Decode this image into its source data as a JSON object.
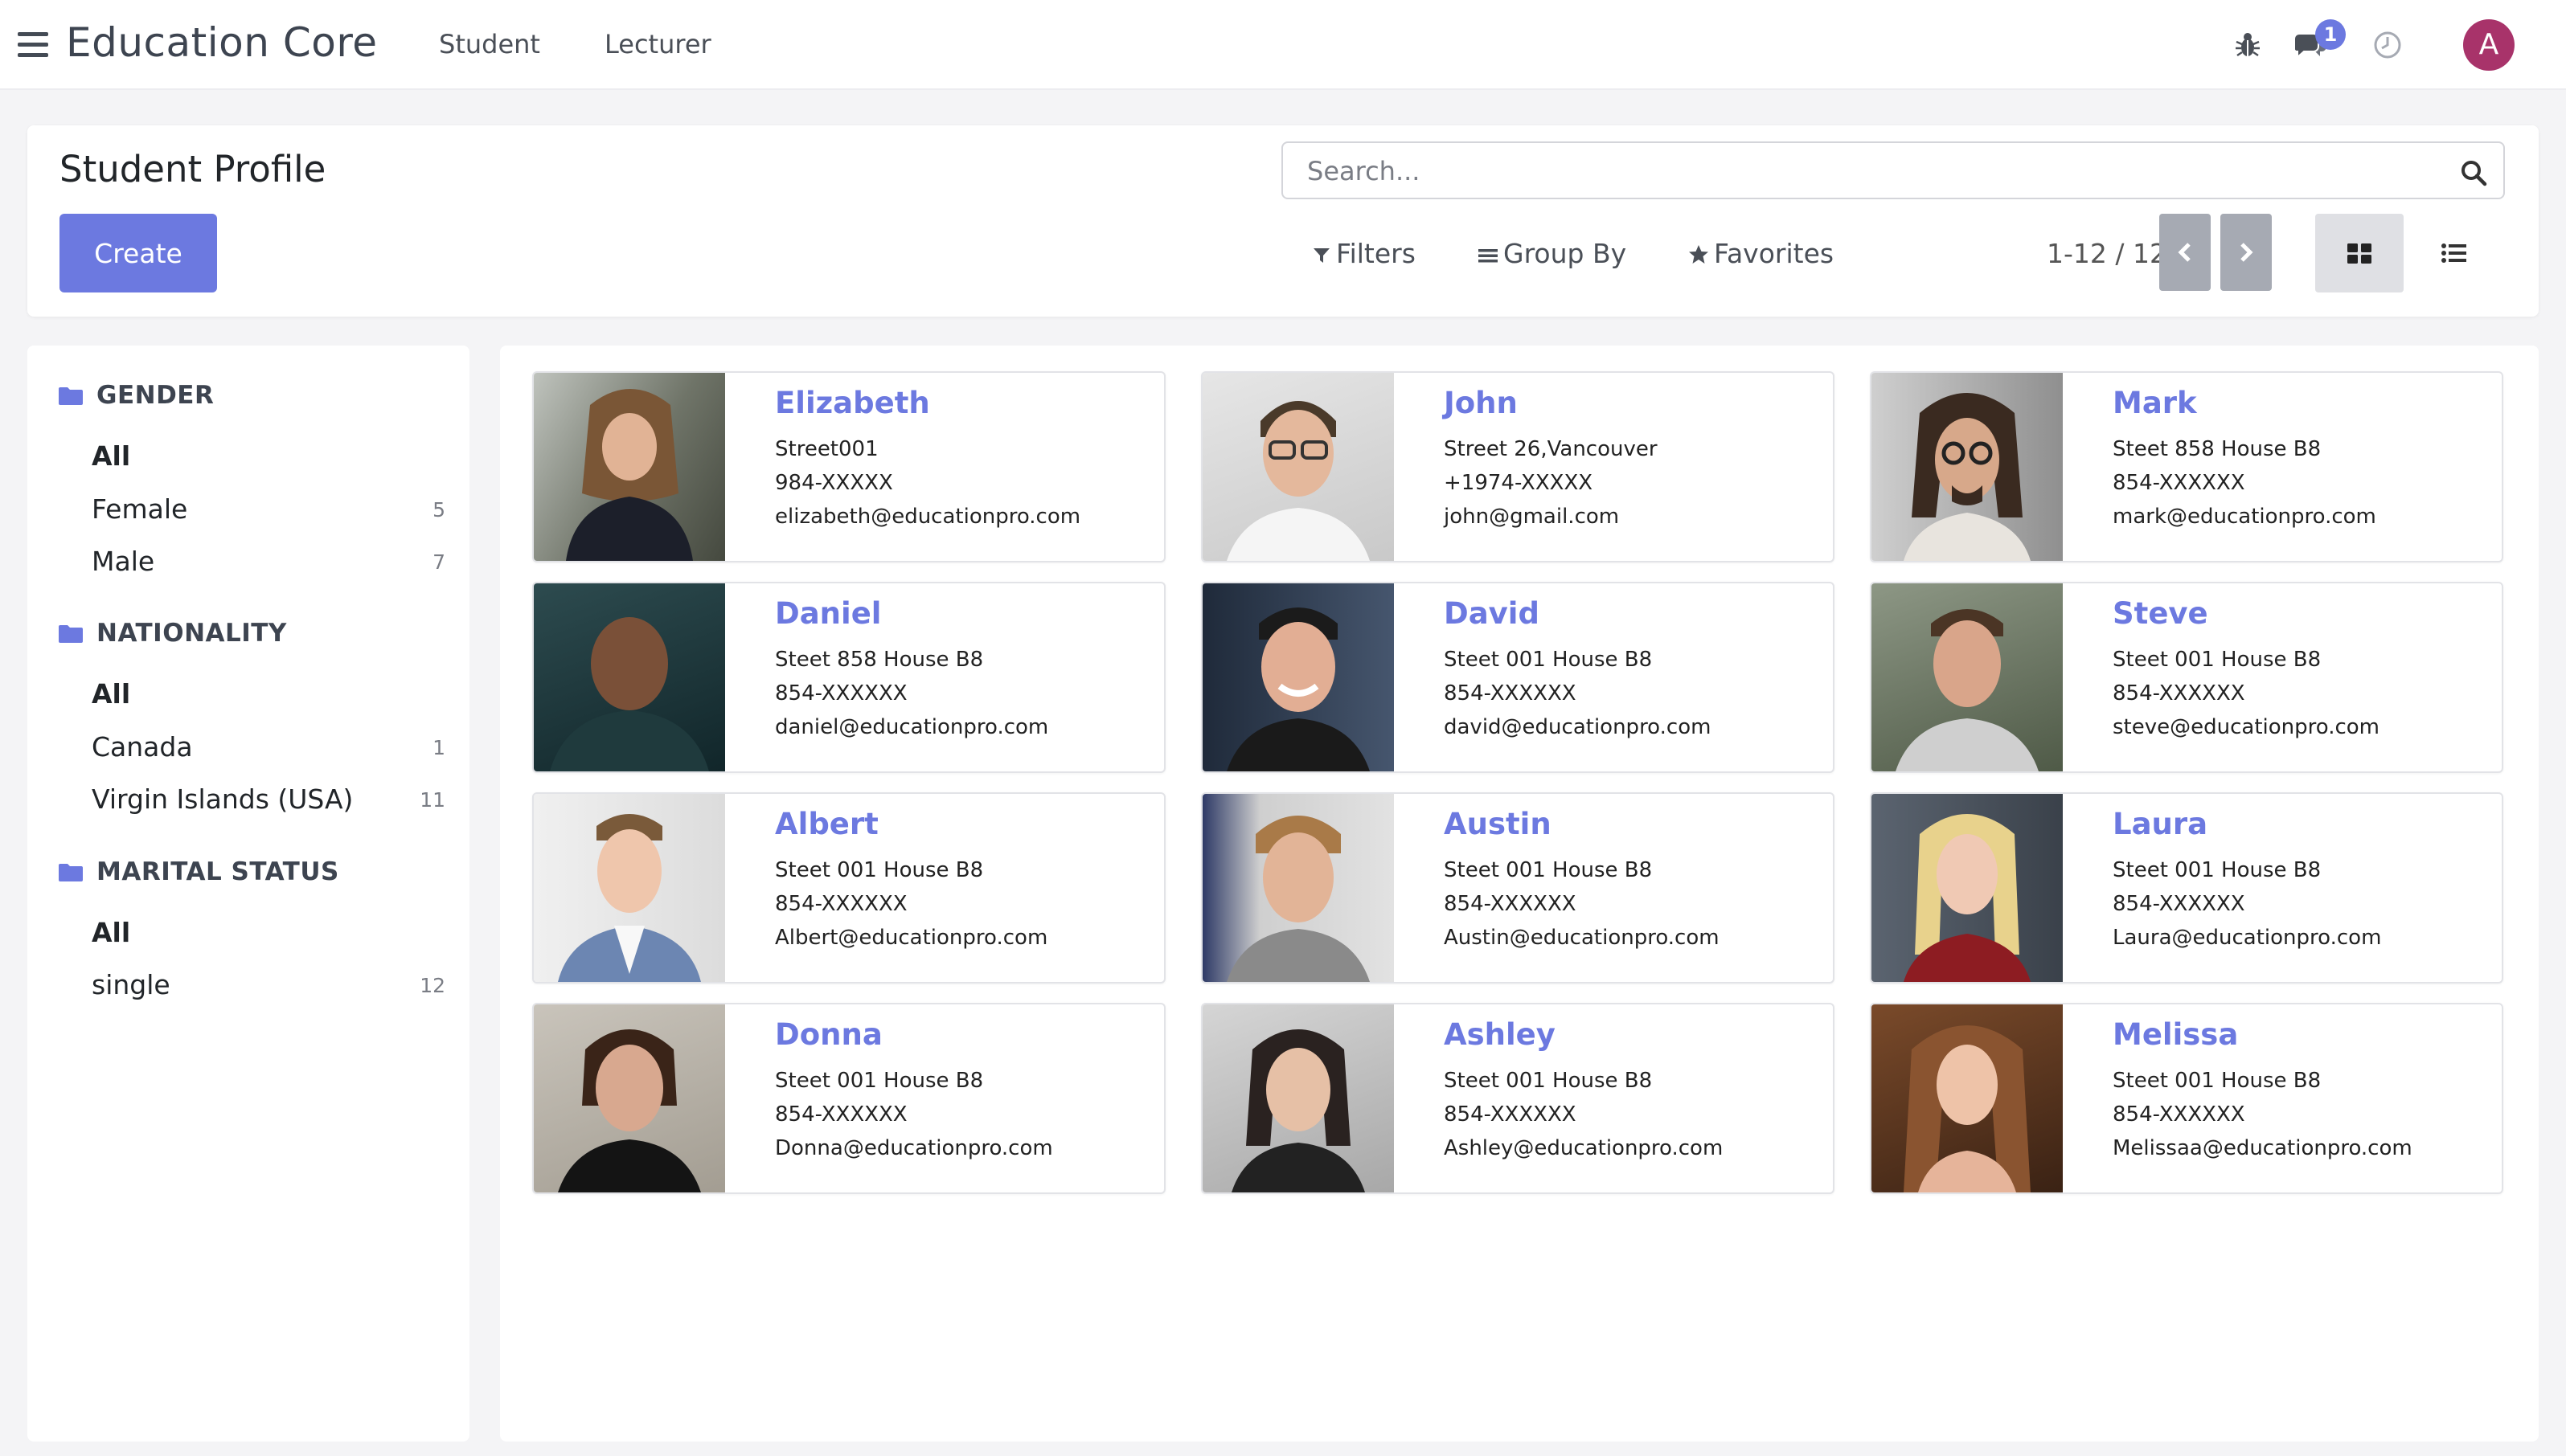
{
  "app": {
    "title": "Education Core"
  },
  "nav": {
    "items": [
      {
        "label": "Student"
      },
      {
        "label": "Lecturer"
      }
    ]
  },
  "systray": {
    "messages_badge": "1",
    "avatar_letter": "A",
    "avatar_color": "#a8336a"
  },
  "control_panel": {
    "title": "Student Profile",
    "create_label": "Create",
    "search_placeholder": "Search...",
    "filters_label": "Filters",
    "groupby_label": "Group By",
    "favorites_label": "Favorites",
    "pager_value": "1-12 / 12"
  },
  "colors": {
    "accent": "#6c79e0",
    "pager_button": "#a6aab3"
  },
  "sidebar": {
    "sections": [
      {
        "title": "GENDER",
        "items": [
          {
            "label": "All",
            "count": ""
          },
          {
            "label": "Female",
            "count": "5"
          },
          {
            "label": "Male",
            "count": "7"
          }
        ]
      },
      {
        "title": "NATIONALITY",
        "items": [
          {
            "label": "All",
            "count": ""
          },
          {
            "label": "Canada",
            "count": "1"
          },
          {
            "label": "Virgin Islands (USA)",
            "count": "11"
          }
        ]
      },
      {
        "title": "MARITAL STATUS",
        "items": [
          {
            "label": "All",
            "count": ""
          },
          {
            "label": "single",
            "count": "12"
          }
        ]
      }
    ]
  },
  "students": [
    {
      "name": "Elizabeth",
      "street": "Street001",
      "phone": "984-XXXXX",
      "email": "elizabeth@educationpro.com"
    },
    {
      "name": "John",
      "street": "Street 26,Vancouver",
      "phone": "+1974-XXXXX",
      "email": "john@gmail.com"
    },
    {
      "name": "Mark",
      "street": "Steet 858 House B8",
      "phone": "854-XXXXXX",
      "email": "mark@educationpro.com"
    },
    {
      "name": "Daniel",
      "street": "Steet 858 House B8",
      "phone": "854-XXXXXX",
      "email": "daniel@educationpro.com"
    },
    {
      "name": "David",
      "street": "Steet 001 House B8",
      "phone": "854-XXXXXX",
      "email": "david@educationpro.com"
    },
    {
      "name": "Steve",
      "street": "Steet 001 House B8",
      "phone": "854-XXXXXX",
      "email": "steve@educationpro.com"
    },
    {
      "name": "Albert",
      "street": "Steet 001 House B8",
      "phone": "854-XXXXXX",
      "email": "Albert@educationpro.com"
    },
    {
      "name": "Austin",
      "street": "Steet 001 House B8",
      "phone": "854-XXXXXX",
      "email": "Austin@educationpro.com"
    },
    {
      "name": "Laura",
      "street": "Steet 001 House B8",
      "phone": "854-XXXXXX",
      "email": "Laura@educationpro.com"
    },
    {
      "name": "Donna",
      "street": "Steet 001 House B8",
      "phone": "854-XXXXXX",
      "email": "Donna@educationpro.com"
    },
    {
      "name": "Ashley",
      "street": "Steet 001 House B8",
      "phone": "854-XXXXXX",
      "email": "Ashley@educationpro.com"
    },
    {
      "name": "Melissa",
      "street": "Steet 001 House B8",
      "phone": "854-XXXXXX",
      "email": "Melissaa@educationpro.com"
    }
  ]
}
